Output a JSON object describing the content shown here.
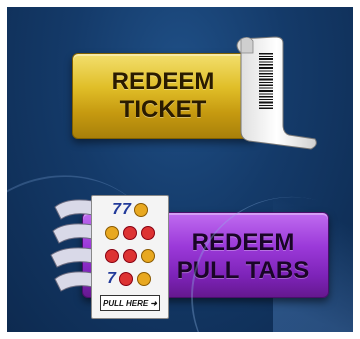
{
  "buttons": {
    "redeem_ticket": {
      "line1": "REDEEM",
      "line2": "TICKET"
    },
    "redeem_pull_tabs": {
      "line1": "REDEEM",
      "line2": "PULL TABS"
    }
  },
  "pull_tab_graphic": {
    "rows": [
      "77",
      "",
      "",
      "7"
    ],
    "footer": "PULL HERE"
  },
  "colors": {
    "background": "#143a69",
    "ticket_button": "#e0be28",
    "pull_tabs_button": "#9b39d9"
  },
  "icons": {
    "ticket": "ticket-printout-icon",
    "pull_tabs": "pull-tab-ticket-icon"
  }
}
